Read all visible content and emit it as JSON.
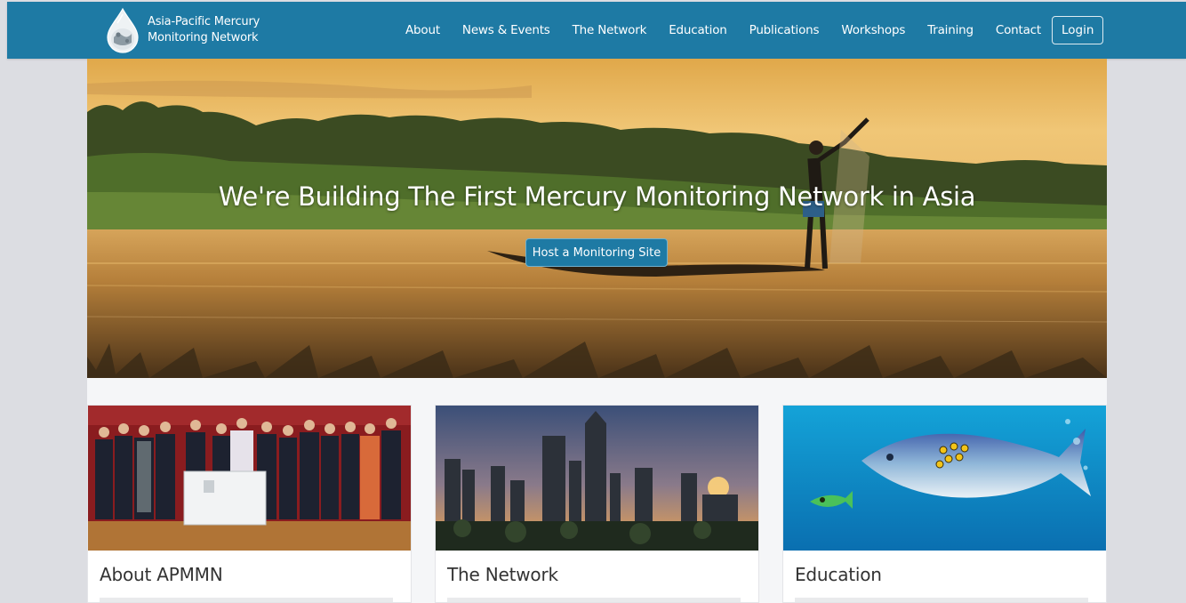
{
  "brand": {
    "line1": "Asia-Pacific Mercury",
    "line2": "Monitoring Network"
  },
  "nav": {
    "items": [
      {
        "label": "About",
        "name": "nav-about"
      },
      {
        "label": "News & Events",
        "name": "nav-news-events"
      },
      {
        "label": "The Network",
        "name": "nav-the-network"
      },
      {
        "label": "Education",
        "name": "nav-education"
      },
      {
        "label": "Publications",
        "name": "nav-publications"
      },
      {
        "label": "Workshops",
        "name": "nav-workshops"
      },
      {
        "label": "Training",
        "name": "nav-training"
      },
      {
        "label": "Contact",
        "name": "nav-contact"
      }
    ],
    "login_label": "Login"
  },
  "hero": {
    "title": "We're Building The First Mercury Monitoring Network in Asia",
    "cta_label": "Host a Monitoring Site"
  },
  "cards": [
    {
      "title": "About APMMN",
      "image": "group-photo"
    },
    {
      "title": "The Network",
      "image": "city-skyline"
    },
    {
      "title": "Education",
      "image": "fish-illustration"
    }
  ],
  "colors": {
    "navbar": "#1e7aa4",
    "page_bg": "#dcdde2",
    "content_bg": "#f5f6f8"
  }
}
